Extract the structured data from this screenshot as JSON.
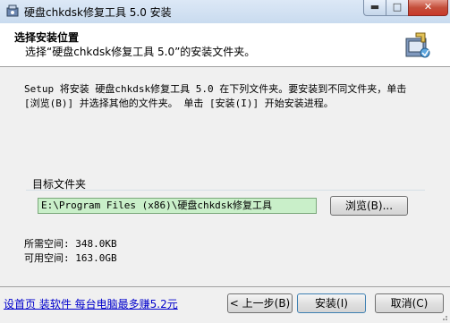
{
  "window": {
    "title": "硬盘chkdsk修复工具 5.0 安装",
    "minimize_glyph": "▬",
    "maximize_glyph": "□",
    "close_glyph": "✕"
  },
  "header": {
    "title": "选择安装位置",
    "subtitle": "选择“硬盘chkdsk修复工具 5.0”的安装文件夹。",
    "icon": "installer-package-icon"
  },
  "body": {
    "description": "Setup 将安装 硬盘chkdsk修复工具 5.0 在下列文件夹。要安装到不同文件夹，单击\n[浏览(B)] 并选择其他的文件夹。 单击 [安装(I)] 开始安装进程。"
  },
  "destination": {
    "group_label": "目标文件夹",
    "path_value": "E:\\Program Files (x86)\\硬盘chkdsk修复工具",
    "browse_label": "浏览(B)..."
  },
  "space": {
    "required": "所需空间: 348.0KB",
    "available": "可用空间: 163.0GB"
  },
  "footer": {
    "brand_link": "设首页 装软件 每台电脑最多赚5.2元",
    "back_label": "< 上一步(B)",
    "install_label": "安装(I)",
    "cancel_label": "取消(C)"
  },
  "colors": {
    "path_field_bg": "#c9efc9",
    "link": "#0000cc"
  }
}
